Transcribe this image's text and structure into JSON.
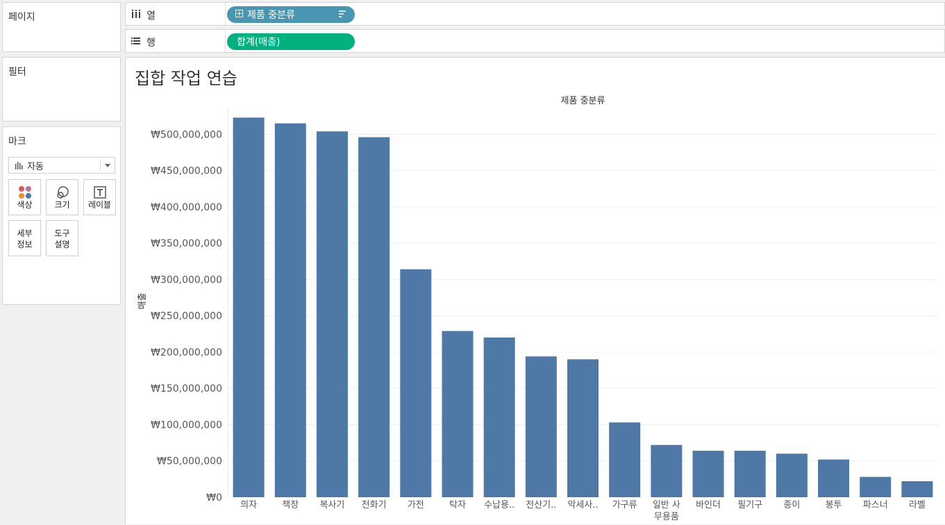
{
  "pages": {
    "title": "페이지"
  },
  "filters": {
    "title": "필터"
  },
  "marks": {
    "title": "마크",
    "type_label": "자동",
    "buttons": {
      "color": "색상",
      "size": "크기",
      "label": "레이블",
      "detail_1": "세부",
      "detail_2": "정보",
      "tooltip_1": "도구",
      "tooltip_2": "설명"
    }
  },
  "columns": {
    "label": "열",
    "pill": "제품 중분류",
    "pill_color": "#4996b2"
  },
  "rows": {
    "label": "행",
    "pill": "합계(매출)",
    "pill_color": "#00b180"
  },
  "sheet": {
    "title": "집합 작업 연습"
  },
  "chart_data": {
    "type": "bar",
    "title": "제품 중분류",
    "xlabel": "",
    "ylabel": "매출",
    "ylim": [
      0,
      530000000
    ],
    "bar_color": "#4e79a7",
    "yticks": [
      0,
      50000000,
      100000000,
      150000000,
      200000000,
      250000000,
      300000000,
      350000000,
      400000000,
      450000000,
      500000000
    ],
    "ytick_labels": [
      "₩0",
      "₩50,000,000",
      "₩100,000,000",
      "₩150,000,000",
      "₩200,000,000",
      "₩250,000,000",
      "₩300,000,000",
      "₩350,000,000",
      "₩400,000,000",
      "₩450,000,000",
      "₩500,000,000"
    ],
    "categories": [
      "의자",
      "책장",
      "복사기",
      "전화기",
      "가전",
      "탁자",
      "수납용..",
      "전산기..",
      "악세사..",
      "가구류",
      "일반 사\n무용품",
      "바인더",
      "필기구",
      "종이",
      "봉투",
      "파스너",
      "라벨"
    ],
    "values": [
      523000000,
      515000000,
      504000000,
      496000000,
      314000000,
      229000000,
      220000000,
      194000000,
      190000000,
      103000000,
      72000000,
      64000000,
      64000000,
      60000000,
      52000000,
      28000000,
      22000000
    ]
  }
}
